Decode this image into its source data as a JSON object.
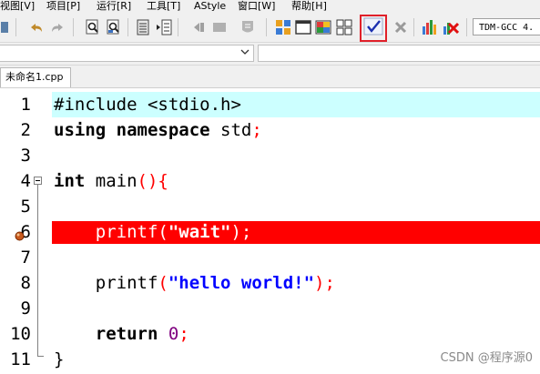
{
  "menu": {
    "items": [
      "视图[V]",
      "项目[P]",
      "运行[R]",
      "工具[T]",
      "AStyle",
      "窗口[W]",
      "帮助[H]"
    ]
  },
  "toolbar": {
    "icons": [
      "undo-icon",
      "redo-icon",
      "find-icon",
      "replace-icon",
      "go-to-icon",
      "indent-icon",
      "unindent-icon",
      "toggle-comment-icon",
      "new-class-icon",
      "layout-icon",
      "windows-icon",
      "grid-icon",
      "check-syntax-icon",
      "close-icon",
      "chart-icon",
      "profile-delete-icon"
    ],
    "highlight_color": "#e0202a",
    "compiler": "TDM-GCC 4."
  },
  "tab": {
    "label": "未命名1.cpp"
  },
  "editor": {
    "lines": [
      {
        "n": "1"
      },
      {
        "n": "2"
      },
      {
        "n": "3"
      },
      {
        "n": "4"
      },
      {
        "n": "5"
      },
      {
        "n": "6"
      },
      {
        "n": "7"
      },
      {
        "n": "8"
      },
      {
        "n": "9"
      },
      {
        "n": "10"
      },
      {
        "n": "11"
      }
    ],
    "code": {
      "l1": "#include <stdio.h>",
      "l2_kw1": "using",
      "l2_kw2": "namespace",
      "l2_rest": " std",
      "l2_semi": ";",
      "l4_kw": "int",
      "l4_rest": " main",
      "l4_paren": "(){",
      "l6_fn": "printf(",
      "l6_str": "\"wait\"",
      "l6_end": ");",
      "l8_fn": "printf",
      "l8_open": "(",
      "l8_str": "\"hello world!\"",
      "l8_close": ");",
      "l10_kw": "return",
      "l10_num": "0",
      "l10_semi": ";",
      "l11": "}"
    },
    "colors": {
      "current_line": "#ccffff",
      "breakpoint_line": "#ff0000",
      "preprocessor": "#008000",
      "string": "#0000ff",
      "symbol": "#ff0000",
      "number": "#800080"
    }
  },
  "watermark": "CSDN @程序源0"
}
